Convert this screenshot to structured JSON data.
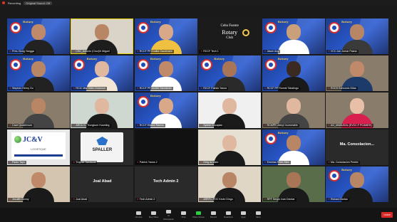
{
  "topbar": {
    "recording_label": "Recording",
    "meeting_pill": "Original Sound: Off"
  },
  "brand": {
    "rotary_word": "Rotary"
  },
  "club_tile": {
    "line1": "Cebu Fuente",
    "line2": "Rotary",
    "line3": "Club"
  },
  "logo_texts": {
    "jcv_title": "JC&V",
    "jcv_sub": "LOGISTIQUE",
    "spaller": "SPALLER"
  },
  "plain_names": {
    "joal": "Joal Abad",
    "tech": "Tech Admin 2",
    "mac": "Ma. Consolacion..."
  },
  "participants": [
    {
      "name": "Pres. Bong Yangga",
      "bg": "rotary",
      "skin": "#c08a6a",
      "shirt": "#222222"
    },
    {
      "name": "CSC_Antonio (Cruz)/h Miguel",
      "bg": "office",
      "skin": "#b88565",
      "shirt": "#1d1d1d"
    },
    {
      "name": "RCCF PP Analita Gaudinaire",
      "bg": "rotary",
      "skin": "#d8a888",
      "shirt": "#f0c040"
    },
    {
      "name": "RCCF Tech 1",
      "bg": "club"
    },
    {
      "name": "Jason Ang",
      "bg": "rotary",
      "skin": "#caa07a",
      "shirt": "#ffffff"
    },
    {
      "name": "VCC Jan Jomar Pasna",
      "bg": "rotary",
      "skin": "#b88565",
      "shirt": "#3a3a3a"
    },
    {
      "name": "Stephen Henry Go",
      "bg": "rotary",
      "skin": "#b88565",
      "shirt": "#222222"
    },
    {
      "name": "RCIC Mia Helen Dolamon",
      "bg": "rotary",
      "skin": "#e0b8a0",
      "shirt": "#f2e5d5"
    },
    {
      "name": "RCCF PP Jenifer Sarmiento",
      "bg": "rotary",
      "skin": "#c08a6a",
      "shirt": "#ffffff"
    },
    {
      "name": "RCCF Patrick Yanos",
      "bg": "rotary",
      "skin": "#a87656",
      "shirt": "#2a2a2a"
    },
    {
      "name": "RCCF PP Ronnie Tabalingo",
      "bg": "rotary",
      "skin": "#3b2a22",
      "shirt": "#1a1a1a"
    },
    {
      "name": "RCDS Edmundo Ditas",
      "bg": "room",
      "skin": "#c08a6a",
      "shirt": "#1c3a6a"
    },
    {
      "name": "Cave Quadrinson",
      "bg": "room",
      "skin": "#b88565",
      "shirt": "#444444"
    },
    {
      "name": "ARCU C. Trungkum Huanting",
      "bg": "window",
      "skin": "#e0b8a0",
      "shirt": "#1a1a1a"
    },
    {
      "name": "RCCF Ellaine Ramos",
      "bg": "rotary",
      "skin": "#d8a888",
      "shirt": "#ffffff"
    },
    {
      "name": "Sydnie Docaplan",
      "bg": "white",
      "skin": "#e0b8a0",
      "shirt": "#1a1a1a"
    },
    {
      "name": "RCMPR Jolinyl Inumerable",
      "bg": "room",
      "skin": "#e0b8a0",
      "shirt": "#444444"
    },
    {
      "name": "AG_MABUGAL (EVCC.F PCAMEH)",
      "bg": "room",
      "skin": "#e8c0a8",
      "shirt": "#d81f4d"
    },
    {
      "name": "Paolo Tayo",
      "bg": "jcv"
    },
    {
      "name": "Trophie Sandoval",
      "bg": "spaller"
    },
    {
      "name": "Patrick Yanos 2",
      "bg": "black"
    },
    {
      "name": "Greg Arnoldo",
      "bg": "portrait",
      "skin": "#e0b8a0",
      "shirt": "#1a1a1a"
    },
    {
      "name": "Emerlan Rhee Alba",
      "bg": "rotary",
      "skin": "#b88565",
      "shirt": "#ffffff"
    },
    {
      "name": "Ma. Consolacion Pestrix",
      "bg": "mac"
    },
    {
      "name": "Jecuiffe Bonny",
      "bg": "photo",
      "skin": "#c08a6a",
      "shirt": "#1a1a1a"
    },
    {
      "name": "Joal Abad",
      "bg": "joal"
    },
    {
      "name": "Tech Admin 2",
      "bg": "tech"
    },
    {
      "name": "ARRFC POC Kevin Dingo",
      "bg": "photo2",
      "skin": "#b88565",
      "shirt": "#1a1a1a"
    },
    {
      "name": "RPF Sergio Ivan Dolotar",
      "bg": "outdoor",
      "skin": "#a87656",
      "shirt": "#1a1a1a"
    },
    {
      "name": "Richard Barlao",
      "bg": "rotary",
      "skin": "#b88565",
      "shirt": "#1a1a1a"
    }
  ],
  "toolbar": {
    "buttons": [
      "Unmute",
      "Stop Video",
      "Participants",
      "Chat",
      "Share Screen",
      "Record",
      "Reactions",
      "Apps",
      "More"
    ],
    "participant_count": "91",
    "end_label": "Leave"
  },
  "colors": {
    "active_border": "#e6d200",
    "end_button": "#d92828",
    "share_button": "#2ecc40",
    "rotary_blue": "#1d4cb5"
  }
}
